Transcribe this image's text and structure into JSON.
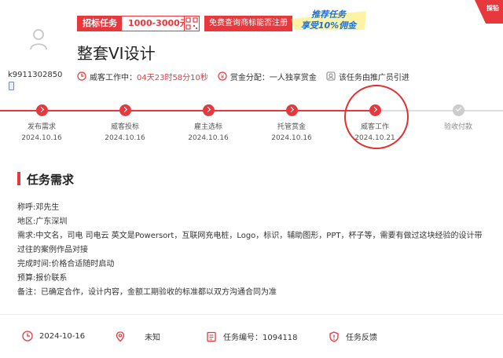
{
  "header": {
    "username": "k9911302850",
    "price_label": "招标任务",
    "price_range": "1000-3000元",
    "free_query": "免费查询商标能否注册",
    "promo_line1": "推荐任务",
    "promo_line2": "享受10%佣金",
    "corner_badge": "採铅",
    "title": "整套VI设计"
  },
  "meta": {
    "status_label": "威客工作中：",
    "countdown": "04天23时58分10秒",
    "reward_label": "赏金分配：一人独享赏金",
    "referral_label": "该任务由推广员引进"
  },
  "steps": [
    {
      "name": "发布需求",
      "date": "2024.10.16",
      "state": "done"
    },
    {
      "name": "威客投标",
      "date": "2024.10.16",
      "state": "done"
    },
    {
      "name": "雇主选标",
      "date": "2024.10.16",
      "state": "done"
    },
    {
      "name": "托管赏金",
      "date": "2024.10.16",
      "state": "done"
    },
    {
      "name": "威客工作",
      "date": "2024.10.21",
      "state": "current"
    },
    {
      "name": "验收付款",
      "date": "",
      "state": "pending"
    }
  ],
  "requirements": {
    "title": "任务需求",
    "lines": [
      "称呼:邓先生",
      "地区:广东深圳",
      "需求:中文名，司电  司电云 英文是Powersort，互联网充电桩，Logo，标识，辅助图形，PPT，杯子等，需要有做过这块经验的设计带过往的案例作品对接",
      "完成时间:价格合适随时启动",
      "预算:报价联系",
      "备注：已确定合作，设计内容，金额工期验收的标准都以双方沟通合同为准"
    ]
  },
  "footer": {
    "date": "2024-10-16",
    "location": "未知",
    "task_no": "任务编号：1094118",
    "feedback": "任务反馈"
  },
  "colors": {
    "accent": "#e8383d",
    "promo_blue": "#1e6fd0",
    "promo_yellow": "#ffe000"
  }
}
